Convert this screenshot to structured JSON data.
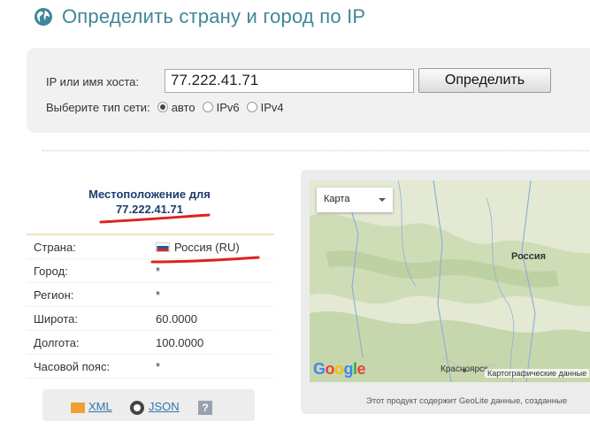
{
  "header": {
    "title": "Определить страну и город по IP",
    "icon": "globe-icon"
  },
  "form": {
    "ip_label": "IP или имя хоста:",
    "ip_value": "77.222.41.71",
    "submit_label": "Определить",
    "network_label": "Выберите тип сети:",
    "options": [
      {
        "label": "авто",
        "checked": true
      },
      {
        "label": "IPv6",
        "checked": false
      },
      {
        "label": "IPv4",
        "checked": false
      }
    ]
  },
  "location": {
    "heading": "Местоположение для",
    "ip": "77.222.41.71",
    "rows": [
      {
        "key": "Страна:",
        "value": "Россия (RU)",
        "flag": "ru-flag"
      },
      {
        "key": "Город:",
        "value": "*"
      },
      {
        "key": "Регион:",
        "value": "*"
      },
      {
        "key": "Широта:",
        "value": "60.0000"
      },
      {
        "key": "Долгота:",
        "value": "100.0000"
      },
      {
        "key": "Часовой пояс:",
        "value": "*"
      }
    ]
  },
  "export": {
    "xml_label": "XML",
    "json_label": "JSON",
    "help_label": "?"
  },
  "map": {
    "type_label": "Карта",
    "country_label": "Россия",
    "logo_text": "Google",
    "city_label": "Красноярск",
    "credit": "Картографические данные",
    "footer_note": "Этот продукт содержит GeoLite данные, созданные"
  },
  "colors": {
    "title": "#3f8797",
    "link": "#3573a8",
    "heading": "#1e3d6b",
    "highlight": "#e02020"
  }
}
